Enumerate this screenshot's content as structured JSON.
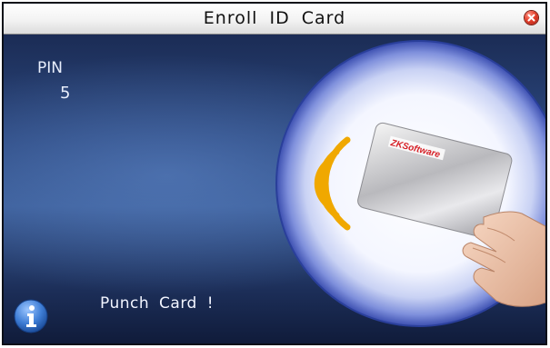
{
  "window": {
    "title": "Enroll ID Card"
  },
  "pin": {
    "label": "PIN",
    "value": "5"
  },
  "status": {
    "message": "Punch Card !"
  },
  "card_brand": "ZKSoftware",
  "icons": {
    "close": "close-icon",
    "info": "info-icon",
    "wave": "rfid-wave-icon"
  },
  "colors": {
    "title_bg": "#f3f3f3",
    "content_bg": "#2d4a82",
    "wave": "#f0a800",
    "close": "#e43f2b",
    "info": "#3f7ed6"
  }
}
